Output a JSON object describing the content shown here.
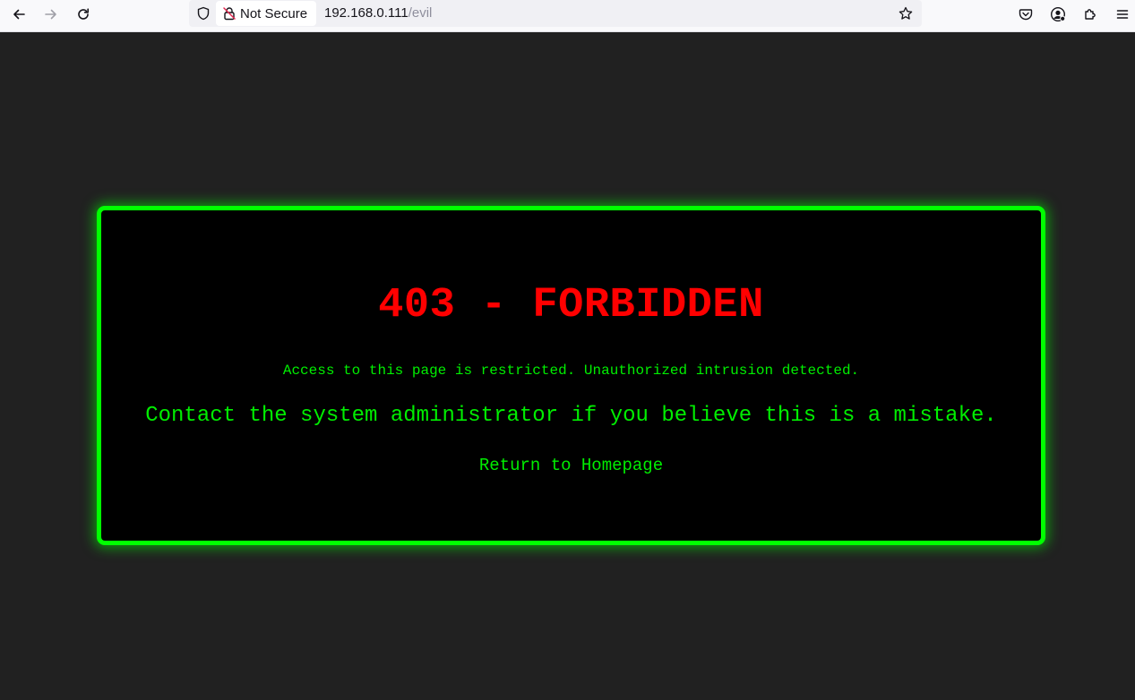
{
  "browser": {
    "back_icon": "arrow-left",
    "forward_icon": "arrow-right",
    "reload_icon": "reload",
    "security_label": "Not Secure",
    "url_host": "192.168.0.111",
    "url_path": "/evil",
    "right_icons": [
      "pocket-icon",
      "account-icon",
      "extensions-icon",
      "menu-icon"
    ]
  },
  "page": {
    "title": "403 - FORBIDDEN",
    "message": "Access to this page is restricted. Unauthorized intrusion detected.",
    "contact": "Contact the system administrator if you believe this is a mistake.",
    "home_link": "Return to Homepage"
  },
  "colors": {
    "background": "#212121",
    "panel": "#000000",
    "border": "#00ff00",
    "title": "#ff0000",
    "text": "#00ee00"
  }
}
